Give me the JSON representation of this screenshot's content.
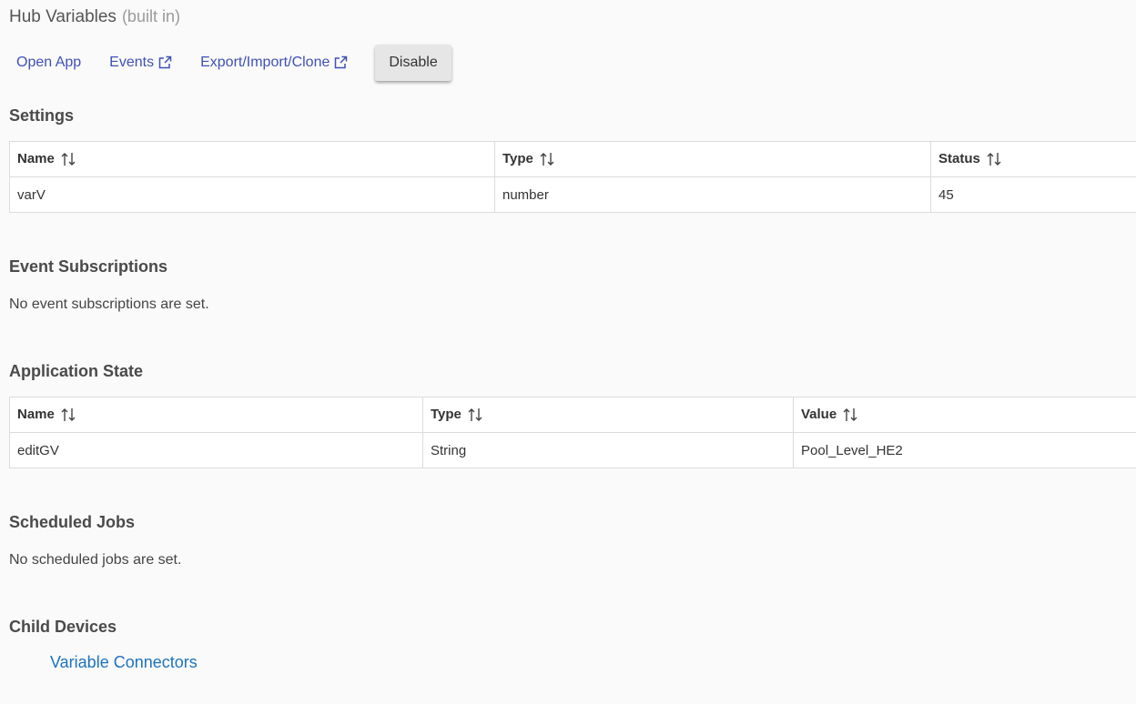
{
  "header": {
    "title": "Hub Variables",
    "subtitle": "(built in)"
  },
  "actions": {
    "open_app": "Open App",
    "events": "Events",
    "export": "Export/Import/Clone",
    "disable": "Disable"
  },
  "settings": {
    "title": "Settings",
    "columns": [
      "Name",
      "Type",
      "Status"
    ],
    "rows": [
      [
        "varV",
        "number",
        "45"
      ]
    ]
  },
  "event_subscriptions": {
    "title": "Event Subscriptions",
    "empty_text": "No event subscriptions are set."
  },
  "application_state": {
    "title": "Application State",
    "columns": [
      "Name",
      "Type",
      "Value"
    ],
    "rows": [
      [
        "editGV",
        "String",
        "Pool_Level_HE2"
      ]
    ]
  },
  "scheduled_jobs": {
    "title": "Scheduled Jobs",
    "empty_text": "No scheduled jobs are set."
  },
  "child_devices": {
    "title": "Child Devices",
    "items": [
      "Variable Connectors"
    ]
  },
  "colors": {
    "link": "#3f51b5",
    "child_link": "#1e73be",
    "background": "#fafafa"
  }
}
